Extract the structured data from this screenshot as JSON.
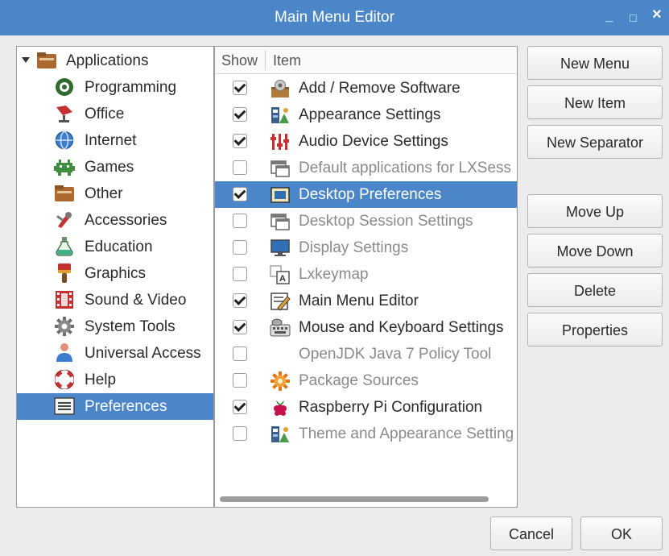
{
  "window": {
    "title": "Main Menu Editor",
    "minimize_glyph": "_",
    "maximize_glyph": "□",
    "close_glyph": "×"
  },
  "tree": {
    "items": [
      {
        "label": "Applications",
        "icon": "applications-folder-icon",
        "expanded": true
      },
      {
        "label": "Programming",
        "icon": "programming-icon"
      },
      {
        "label": "Office",
        "icon": "office-icon"
      },
      {
        "label": "Internet",
        "icon": "globe-icon"
      },
      {
        "label": "Games",
        "icon": "games-icon"
      },
      {
        "label": "Other",
        "icon": "folder-icon"
      },
      {
        "label": "Accessories",
        "icon": "accessories-icon"
      },
      {
        "label": "Education",
        "icon": "education-icon"
      },
      {
        "label": "Graphics",
        "icon": "graphics-icon"
      },
      {
        "label": "Sound & Video",
        "icon": "sound-video-icon"
      },
      {
        "label": "System Tools",
        "icon": "gear-icon"
      },
      {
        "label": "Universal Access",
        "icon": "universal-access-icon"
      },
      {
        "label": "Help",
        "icon": "lifebuoy-icon"
      },
      {
        "label": "Preferences",
        "icon": "preferences-icon",
        "selected": true
      }
    ]
  },
  "list": {
    "headers": {
      "show": "Show",
      "item": "Item"
    },
    "rows": [
      {
        "label": "Add / Remove Software",
        "checked": true,
        "icon": "package-icon"
      },
      {
        "label": "Appearance Settings",
        "checked": true,
        "icon": "appearance-icon"
      },
      {
        "label": "Audio Device Settings",
        "checked": true,
        "icon": "audio-mixer-icon"
      },
      {
        "label": "Default applications for LXSess",
        "checked": false,
        "icon": "window-icon"
      },
      {
        "label": "Desktop Preferences",
        "checked": true,
        "icon": "desktop-icon",
        "selected": true
      },
      {
        "label": "Desktop Session Settings",
        "checked": false,
        "icon": "window-icon"
      },
      {
        "label": "Display Settings",
        "checked": false,
        "icon": "monitor-icon"
      },
      {
        "label": "Lxkeymap",
        "checked": false,
        "icon": "keymap-icon"
      },
      {
        "label": "Main Menu Editor",
        "checked": true,
        "icon": "menu-editor-icon"
      },
      {
        "label": "Mouse and Keyboard Settings",
        "checked": true,
        "icon": "keyboard-icon"
      },
      {
        "label": "OpenJDK Java 7 Policy Tool",
        "checked": false,
        "icon": "none"
      },
      {
        "label": "Package Sources",
        "checked": false,
        "icon": "sun-gear-icon"
      },
      {
        "label": "Raspberry Pi Configuration",
        "checked": true,
        "icon": "raspberry-icon"
      },
      {
        "label": "Theme and Appearance Setting",
        "checked": false,
        "icon": "appearance-icon"
      }
    ]
  },
  "buttons": {
    "new_menu": "New Menu",
    "new_item": "New Item",
    "new_separator": "New Separator",
    "move_up": "Move Up",
    "move_down": "Move Down",
    "delete": "Delete",
    "properties": "Properties",
    "cancel": "Cancel",
    "ok": "OK"
  },
  "colors": {
    "titlebar": "#4b86c8",
    "selection": "#4b86c8",
    "background": "#ececec"
  }
}
